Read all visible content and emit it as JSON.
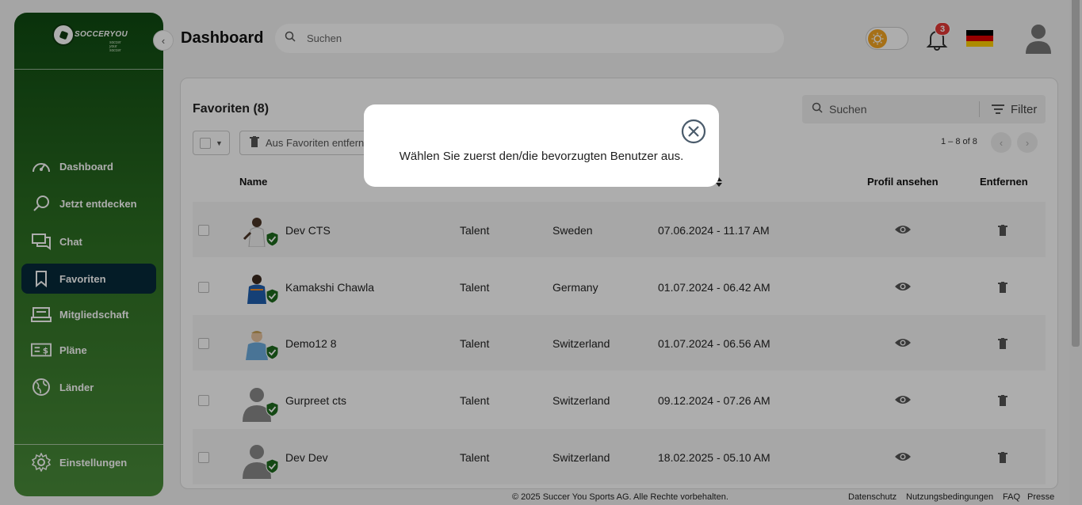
{
  "brand": {
    "name": "SOCCERYOU",
    "tagline": "soccer your soccer"
  },
  "sidebar": {
    "items": [
      {
        "label": "Dashboard",
        "icon": "gauge-icon"
      },
      {
        "label": "Jetzt entdecken",
        "icon": "search-icon"
      },
      {
        "label": "Chat",
        "icon": "chat-icon"
      },
      {
        "label": "Favoriten",
        "icon": "bookmark-icon",
        "active": true
      },
      {
        "label": "Mitgliedschaft",
        "icon": "membership-icon"
      },
      {
        "label": "Pläne",
        "icon": "plans-icon"
      },
      {
        "label": "Länder",
        "icon": "globe-icon"
      }
    ],
    "settings_label": "Einstellungen"
  },
  "header": {
    "title": "Dashboard",
    "search_placeholder": "Suchen",
    "notification_count": "3",
    "language_flag": "de"
  },
  "favorites": {
    "title": "Favoriten (8)",
    "search_placeholder": "Suchen",
    "filter_label": "Filter",
    "remove_label": "Aus Favoriten entfernen",
    "pager": "1 – 8 of 8",
    "columns": {
      "name": "Name",
      "view": "Profil ansehen",
      "remove": "Entfernen"
    },
    "rows": [
      {
        "name": "Dev CTS",
        "role": "Talent",
        "country": "Sweden",
        "date": "07.06.2024 - 11.17 AM"
      },
      {
        "name": "Kamakshi Chawla",
        "role": "Talent",
        "country": "Germany",
        "date": "01.07.2024 - 06.42 AM"
      },
      {
        "name": "Demo12 8",
        "role": "Talent",
        "country": "Switzerland",
        "date": "01.07.2024 - 06.56 AM"
      },
      {
        "name": "Gurpreet cts",
        "role": "Talent",
        "country": "Switzerland",
        "date": "09.12.2024 - 07.26 AM"
      },
      {
        "name": "Dev Dev",
        "role": "Talent",
        "country": "Switzerland",
        "date": "18.02.2025 - 05.10 AM"
      }
    ]
  },
  "modal": {
    "message": "Wählen Sie zuerst den/die bevorzugten Benutzer aus."
  },
  "footer": {
    "copyright": "© 2025 Succer You Sports AG. Alle Rechte vorbehalten.",
    "links": [
      "Datenschutz",
      "Nutzungsbedingungen",
      "FAQ",
      "Presse"
    ]
  },
  "colors": {
    "sidebar_top": "#0f4a12",
    "sidebar_bottom": "#4a8c3a",
    "active_nav": "#062a3a",
    "badge": "#e53935",
    "verified": "#1e6b1e"
  }
}
